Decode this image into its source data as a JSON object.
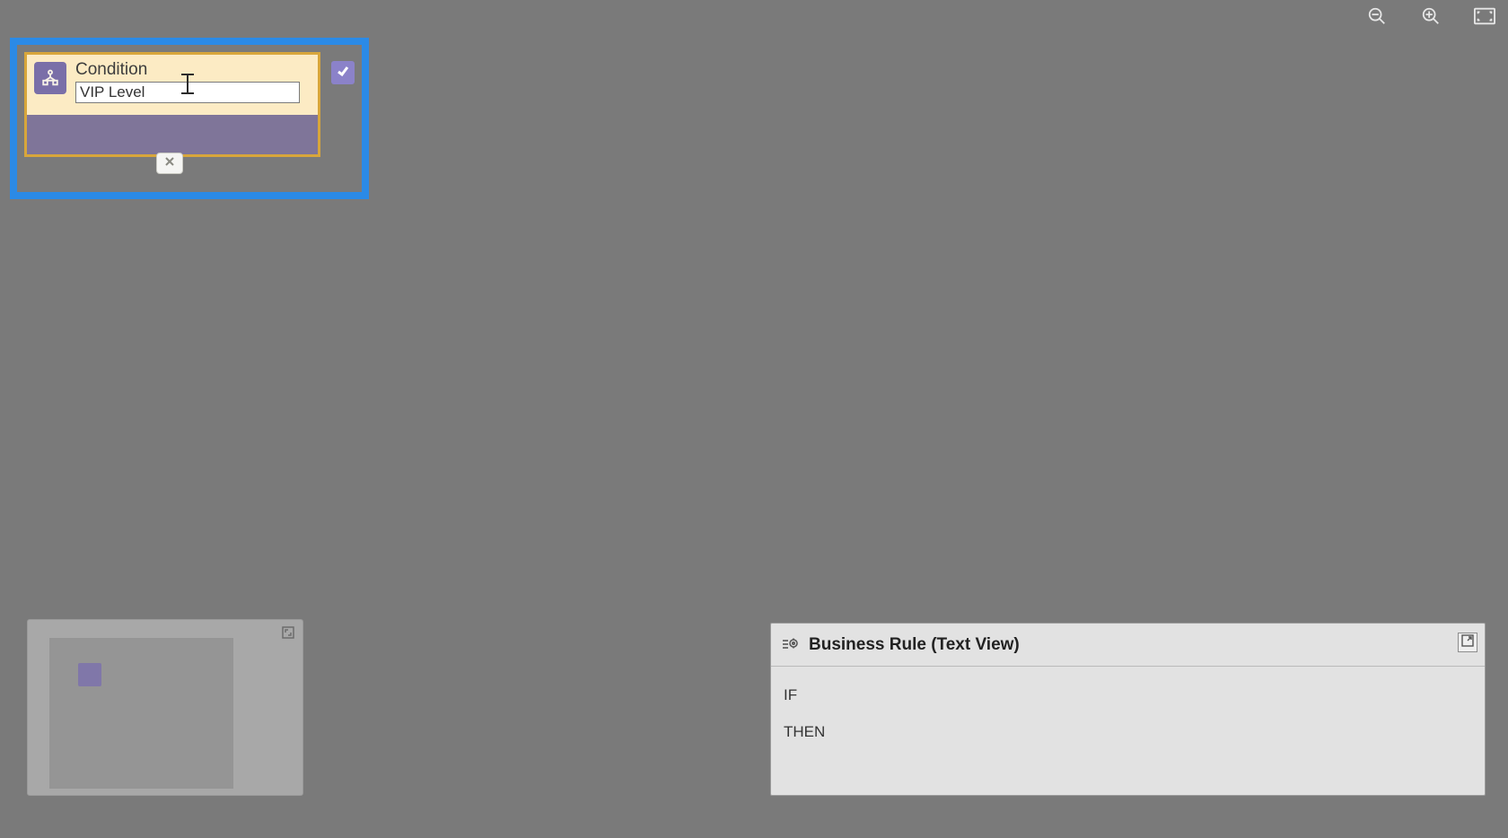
{
  "toolbar": {
    "zoom_out": "zoom-out",
    "zoom_in": "zoom-in",
    "fit": "fit-to-screen"
  },
  "condition_node": {
    "label": "Condition",
    "name_value": "VIP Level",
    "check_icon": "checkmark",
    "close_icon": "close"
  },
  "minimap": {
    "expand_icon": "expand"
  },
  "text_view": {
    "title": "Business Rule (Text View)",
    "lines": {
      "if": "IF",
      "then": "THEN"
    }
  }
}
